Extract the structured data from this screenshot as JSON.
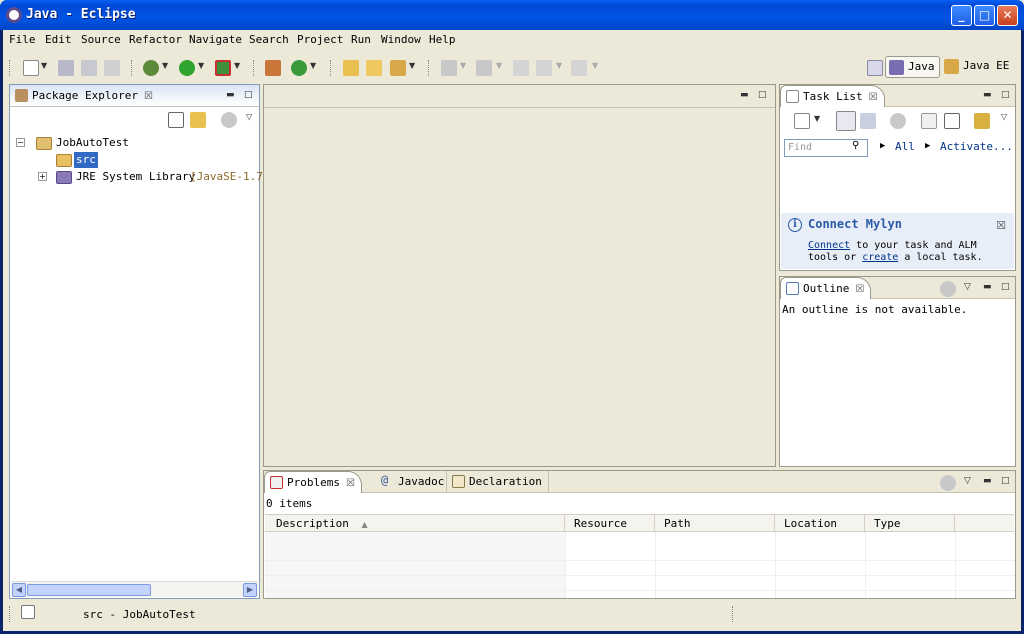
{
  "window": {
    "title": "Java - Eclipse",
    "controls": {
      "minimize": "_",
      "maximize": "□",
      "close": "✕"
    }
  },
  "menubar": {
    "items": [
      "File",
      "Edit",
      "Source",
      "Refactor",
      "Navigate",
      "Search",
      "Project",
      "Run",
      "Window",
      "Help"
    ]
  },
  "toolbar": {
    "icons": [
      "new-icon",
      "save-icon",
      "save-all-icon",
      "print-icon",
      "debug-icon",
      "run-icon",
      "external-tools-icon",
      "new-java-project-icon",
      "new-class-icon",
      "open-type-icon",
      "open-task-icon",
      "search-icon",
      "next-annotation-icon",
      "prev-annotation-icon",
      "last-edit-icon",
      "back-icon",
      "forward-icon"
    ],
    "perspectives": [
      {
        "label": "Java",
        "active": true
      },
      {
        "label": "Java EE",
        "active": false
      }
    ]
  },
  "package_explorer": {
    "tab_label": "Package Explorer",
    "tree": [
      {
        "label": "JobAutoTest",
        "expanded": true
      },
      {
        "label": "src",
        "selected": true
      },
      {
        "label": "JRE System Library",
        "suffix": "[JavaSE-1.7]"
      }
    ]
  },
  "task_list": {
    "tab_label": "Task List",
    "find_placeholder": "Find",
    "filter_all": "All",
    "activate": "Activate...",
    "mylyn_title": "Connect Mylyn",
    "mylyn_connect": "Connect",
    "mylyn_text1": " to your task and ALM",
    "mylyn_text2": "tools or ",
    "mylyn_create": "create",
    "mylyn_text3": " a local task."
  },
  "outline": {
    "tab_label": "Outline",
    "message": "An outline is not available."
  },
  "bottom": {
    "tabs": [
      "Problems",
      "Javadoc",
      "Declaration"
    ],
    "items_count": "0 items",
    "columns": [
      "Description",
      "Resource",
      "Path",
      "Location",
      "Type"
    ]
  },
  "status": {
    "text": "src - JobAutoTest"
  },
  "colors": {
    "titlebar": "#0054e3",
    "chrome": "#ece9d8",
    "selection": "#316ac5",
    "link": "#00338a"
  }
}
